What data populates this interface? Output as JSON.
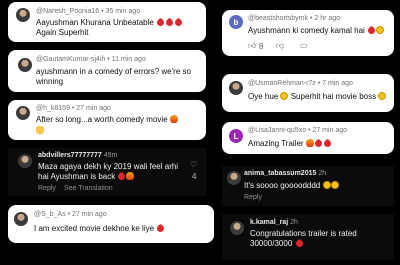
{
  "left": [
    {
      "user": "@Naresh_Poonia16 • 35 min ago",
      "lines": [
        "Aayushman Khurana Unbeatable",
        "Again Superhit"
      ],
      "avatar_color": "#c0392b"
    },
    {
      "user": "@GautamKumar-sj4ih • 11 min ago",
      "lines": [
        "ayushmann in a comedy of errors? we're so",
        "winning"
      ],
      "avatar_color": "#8e44ad"
    },
    {
      "user": "@h_k8159 • 27 min ago",
      "lines": [
        "After so long...a worth comedy movie"
      ],
      "avatar_color": "#d35400"
    },
    {
      "user": "abdvillers77777777",
      "time": "49m",
      "lines": [
        "Maza agaya dekh ky 2019 wali feel arhi",
        "hai Ayushman is back"
      ],
      "like_count": "4",
      "reply_label": "Reply",
      "see_translation_label": "See Translation"
    },
    {
      "user": "@S_b_As • 27 min ago",
      "lines": [
        "I am excited movie dekhne ke liye"
      ]
    }
  ],
  "right": [
    {
      "user": "@beastshortsbymk • 2 hr ago",
      "lines": [
        "Ayushmann ki comedy kamal hai"
      ],
      "like_count": "8",
      "avatar_letter": "b",
      "avatar_color": "#5c6bc0"
    },
    {
      "user": "@UsmanRehman-r7z • 7 min ago",
      "lines": [
        "Oye hue",
        "Superhit hai movie boss"
      ],
      "avatar_color": "#e91e63"
    },
    {
      "user": "@LisaJanni-qu5xo • 27 min ago",
      "lines": [
        "Amazing Trailer"
      ],
      "avatar_letter": "L",
      "avatar_color": "#9c27b0"
    },
    {
      "user": "anima_tabassum2015",
      "time": "2h",
      "lines": [
        "It's soooo goooodddd"
      ],
      "reply_label": "Reply"
    },
    {
      "user": "k.kamal_raj",
      "time": "2h",
      "lines": [
        "Congratulations trailer is rated",
        "30000/3000"
      ]
    }
  ]
}
